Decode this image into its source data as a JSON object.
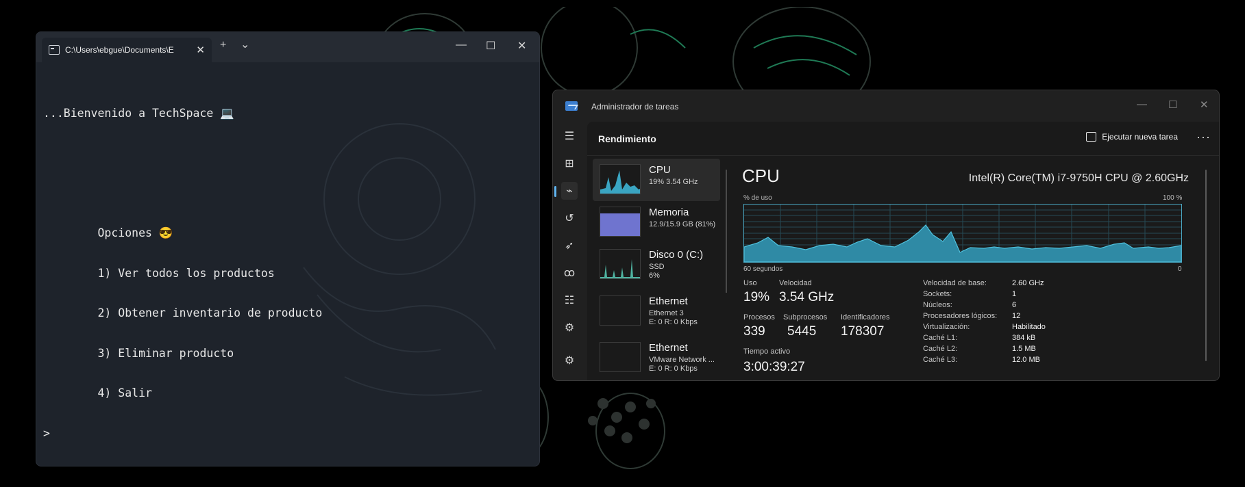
{
  "terminal": {
    "tab_title": "C:\\Users\\ebgue\\Documents\\E",
    "close_glyph": "✕",
    "new_tab_glyph": "+",
    "dropdown_glyph": "⌄",
    "minimize_glyph": "—",
    "maximize_glyph": "☐",
    "window_close_glyph": "✕",
    "lines": [
      "...Bienvenido a TechSpace 💻",
      "",
      "",
      "        Opciones 😎",
      "        1) Ver todos los productos",
      "        2) Obtener inventario de producto",
      "        3) Eliminar producto",
      "        4) Salir",
      ">"
    ]
  },
  "taskmanager": {
    "app_title": "Administrador de tareas",
    "window_buttons": {
      "minimize": "—",
      "maximize": "☐",
      "close": "✕"
    },
    "section_title": "Rendimiento",
    "run_task_label": "Ejecutar nueva tarea",
    "more_glyph": "···",
    "nav_icons": [
      "hamburger-icon",
      "processes-icon",
      "performance-icon",
      "history-icon",
      "startup-icon",
      "users-icon",
      "details-icon",
      "services-icon",
      "settings-icon"
    ],
    "nav_glyphs": [
      "☰",
      "⊞",
      "⌁",
      "↺",
      "➶",
      "ꝏ",
      "☷",
      "⚙",
      "⚙"
    ],
    "resources": [
      {
        "name": "CPU",
        "sub1": "19% 3.54 GHz",
        "sub2": "",
        "sub3": ""
      },
      {
        "name": "Memoria",
        "sub1": "12.9/15.9 GB (81%)",
        "sub2": "",
        "sub3": ""
      },
      {
        "name": "Disco 0 (C:)",
        "sub1": "SSD",
        "sub2": "6%",
        "sub3": ""
      },
      {
        "name": "Ethernet",
        "sub1": "Ethernet 3",
        "sub2": "E: 0 R: 0 Kbps",
        "sub3": ""
      },
      {
        "name": "Ethernet",
        "sub1": "VMware Network ...",
        "sub2": "E: 0 R: 0 Kbps",
        "sub3": ""
      }
    ],
    "cpu": {
      "title": "CPU",
      "model": "Intel(R) Core(TM) i7-9750H CPU @ 2.60GHz",
      "usage_label": "% de uso",
      "usage_max": "100 %",
      "time_label": "60 segundos",
      "time_min": "0",
      "stats": {
        "uso_label": "Uso",
        "uso_value": "19%",
        "velocidad_label": "Velocidad",
        "velocidad_value": "3.54 GHz",
        "procesos_label": "Procesos",
        "procesos_value": "339",
        "subprocesos_label": "Subprocesos",
        "subprocesos_value": "5445",
        "identificadores_label": "Identificadores",
        "identificadores_value": "178307",
        "tiempo_label": "Tiempo activo",
        "tiempo_value": "3:00:39:27"
      },
      "info": [
        {
          "label": "Velocidad de base:",
          "value": "2.60 GHz"
        },
        {
          "label": "Sockets:",
          "value": "1"
        },
        {
          "label": "Núcleos:",
          "value": "6"
        },
        {
          "label": "Procesadores lógicos:",
          "value": "12"
        },
        {
          "label": "Virtualización:",
          "value": "Habilitado"
        },
        {
          "label": "Caché L1:",
          "value": "384 kB"
        },
        {
          "label": "Caché L2:",
          "value": "1.5 MB"
        },
        {
          "label": "Caché L3:",
          "value": "12.0 MB"
        }
      ]
    },
    "colors": {
      "cpu": "#3aa5c2",
      "memory": "#6f74cf",
      "disk": "#4fb3a1",
      "accent": "#60b5f0"
    }
  }
}
